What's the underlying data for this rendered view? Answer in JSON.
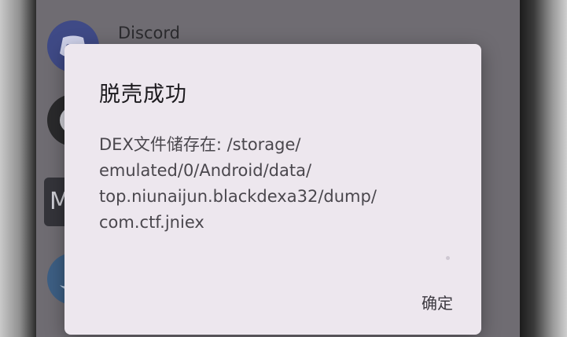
{
  "background_apps": [
    {
      "label": "Discord",
      "icon": "discord-icon"
    },
    {
      "label": "",
      "icon": "github-icon"
    },
    {
      "label": "",
      "icon": "m-app-icon",
      "glyph": "M"
    },
    {
      "label": "",
      "icon": "bird-icon"
    }
  ],
  "dialog": {
    "title": "脱壳成功",
    "message_lines": [
      "DEX文件储存在: /storage/",
      "emulated/0/Android/data/",
      "top.niunaijun.blackdexa32/dump/",
      "com.ctf.jniex"
    ],
    "confirm_label": "确定"
  },
  "colors": {
    "dialog_background": "#ede7ee",
    "scrim": "#6f6c72"
  }
}
